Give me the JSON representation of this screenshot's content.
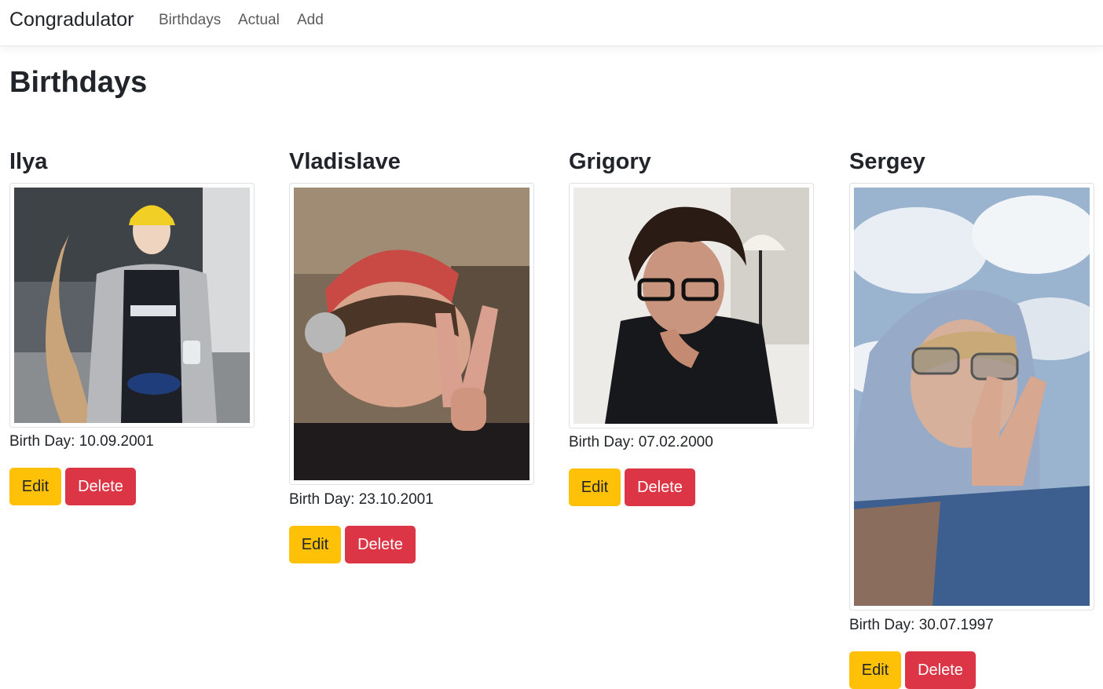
{
  "navbar": {
    "brand": "Congradulator",
    "links": [
      "Birthdays",
      "Actual",
      "Add"
    ]
  },
  "page": {
    "title": "Birthdays"
  },
  "people": [
    {
      "name": "Ilya",
      "birth_text": "Birth Day: 10.09.2001"
    },
    {
      "name": "Vladislave",
      "birth_text": "Birth Day: 23.10.2001"
    },
    {
      "name": "Grigory",
      "birth_text": "Birth Day: 07.02.2000"
    },
    {
      "name": "Sergey",
      "birth_text": "Birth Day: 30.07.1997"
    }
  ],
  "buttons": {
    "edit": "Edit",
    "delete": "Delete"
  },
  "colors": {
    "edit": "#ffc107",
    "delete": "#dc3545"
  }
}
